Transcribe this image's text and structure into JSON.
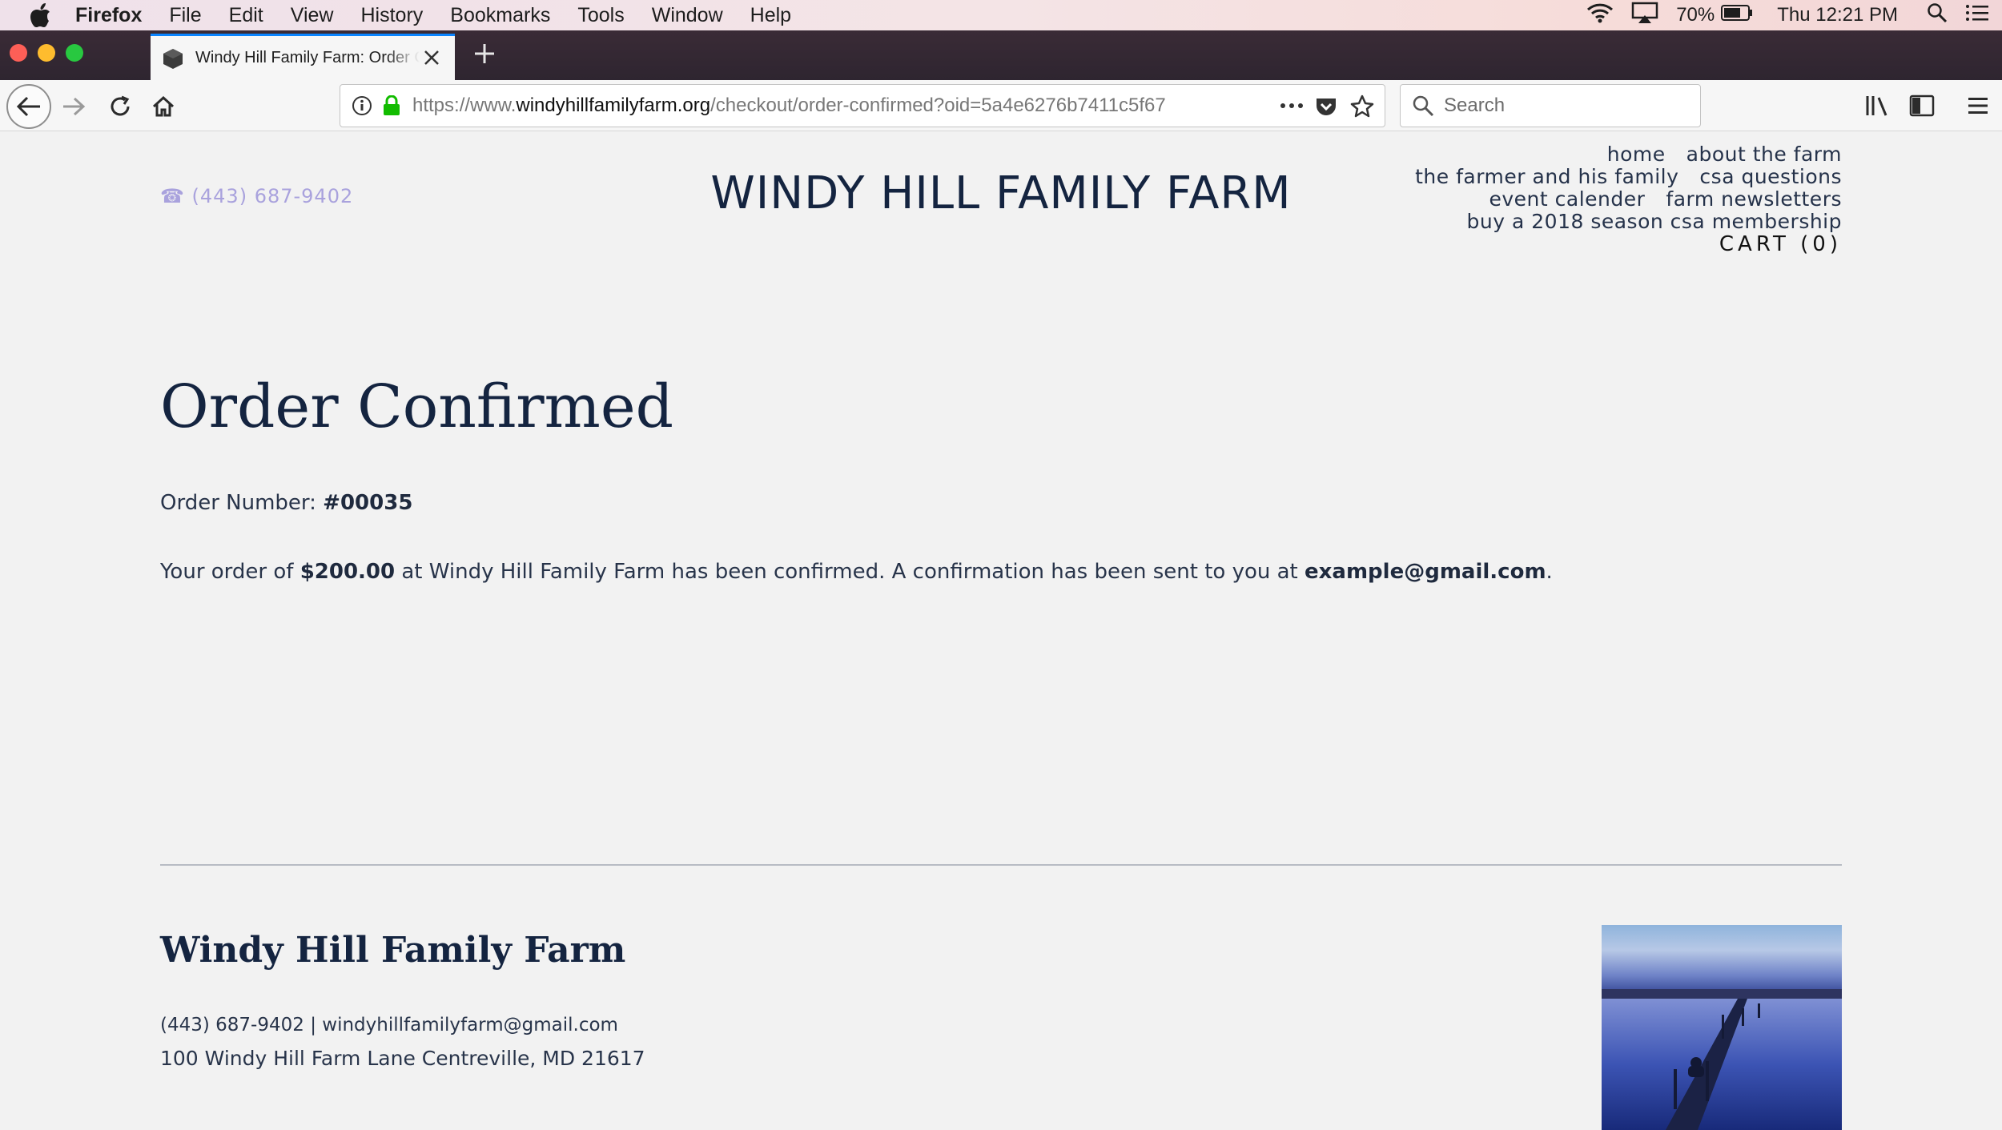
{
  "menubar": {
    "app_name": "Firefox",
    "items": [
      "File",
      "Edit",
      "View",
      "History",
      "Bookmarks",
      "Tools",
      "Window",
      "Help"
    ],
    "battery": "70%",
    "clock": "Thu 12:21 PM"
  },
  "tab": {
    "title": "Windy Hill Family Farm: Order Confirmed"
  },
  "urlbar": {
    "scheme_prefix": "https://www.",
    "domain": "windyhillfamilyfarm.org",
    "path": "/checkout/order-confirmed?oid=5a4e6276b7411c5f67"
  },
  "search": {
    "placeholder": "Search"
  },
  "site": {
    "phone": "☎ (443) 687-9402",
    "title": "WINDY HILL FAMILY FARM",
    "nav": {
      "home": "home",
      "about": "about the farm",
      "farmer": "the farmer and his family",
      "csa_questions": "csa questions",
      "events": "event calender",
      "newsletters": "farm newsletters",
      "membership": "buy a 2018 season csa membership",
      "cart": "CART (0)"
    }
  },
  "order": {
    "heading": "Order Confirmed",
    "number_label": "Order Number: ",
    "number": "#00035",
    "text_1": "Your order of ",
    "amount": "$200.00",
    "text_2": " at Windy Hill Family Farm has been confirmed. A confirmation has been sent to you at ",
    "email": "example@gmail.com",
    "text_3": "."
  },
  "footer": {
    "title": "Windy Hill Family Farm",
    "contact": "(443) 687-9402 | windyhillfamilyfarm@gmail.com",
    "address": "100 Windy Hill Farm Lane Centreville, MD 21617"
  },
  "colors": {
    "accent_tab": "#0a84ff",
    "heading": "#142440",
    "phone": "#a9a2dd",
    "lock": "#12bc00"
  }
}
